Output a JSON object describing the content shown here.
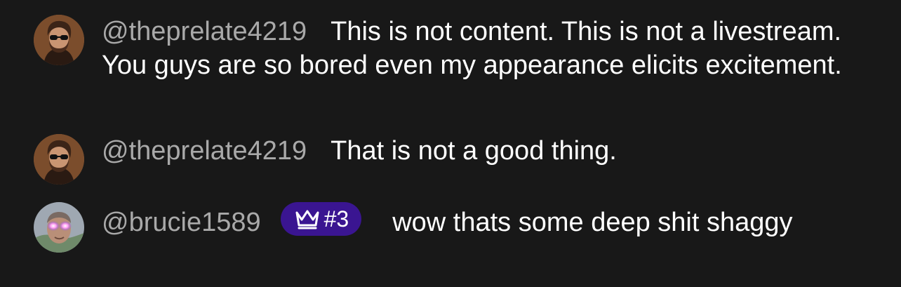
{
  "comments": [
    {
      "username": "@theprelate4219",
      "text": "This is not content. This is not a livestream. You guys are so bored even my appearance elicits excitement.",
      "avatar": "man-with-sunglasses-avatar"
    },
    {
      "username": "@theprelate4219",
      "text": "That is not a good thing.",
      "avatar": "man-with-sunglasses-avatar"
    },
    {
      "username": "@brucie1589",
      "badge": "#3",
      "badge_icon": "crown-icon",
      "text": "wow thats some deep shit shaggy",
      "avatar": "glowing-eyes-avatar"
    }
  ],
  "colors": {
    "background": "#181818",
    "username": "#a9a9a9",
    "text": "#ffffff",
    "badge": "#3a1591"
  }
}
